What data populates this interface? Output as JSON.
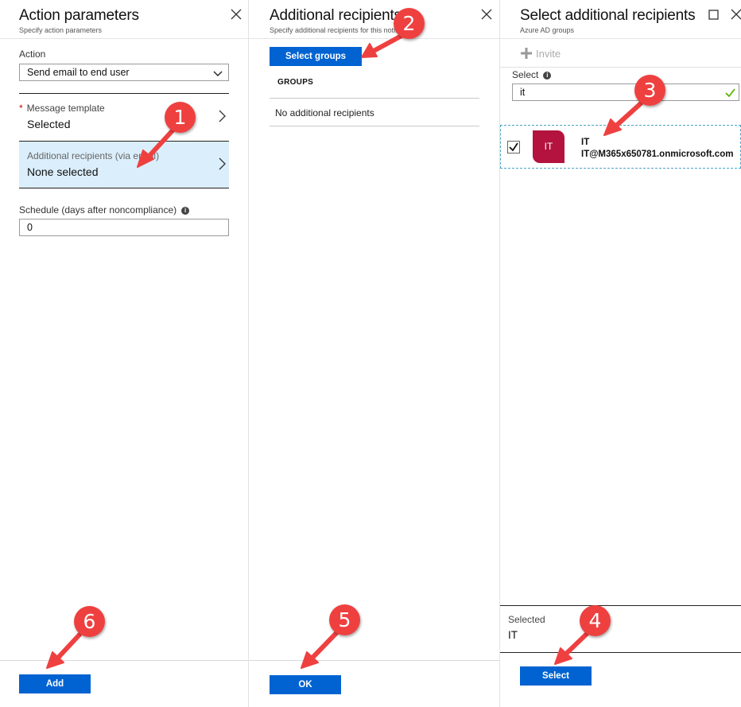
{
  "blade1": {
    "title": "Action parameters",
    "subtitle": "Specify action parameters",
    "action_label": "Action",
    "action_value": "Send email to end user",
    "required_mark": "*",
    "message_template_label": "Message template",
    "message_template_value": "Selected",
    "additional_label": "Additional recipients (via email)",
    "additional_value": "None selected",
    "schedule_label": "Schedule (days after noncompliance)",
    "schedule_value": "0",
    "add_button": "Add"
  },
  "blade2": {
    "title": "Additional recipients",
    "subtitle": "Specify additional recipients for this notification",
    "select_groups_button": "Select groups",
    "groups_header": "GROUPS",
    "empty_text": "No additional recipients",
    "ok_button": "OK"
  },
  "blade3": {
    "title": "Select additional recipients",
    "subtitle": "Azure AD groups",
    "invite_label": "Invite",
    "select_label": "Select",
    "search_value": "it",
    "group": {
      "initials": "IT",
      "name": "IT",
      "email": "IT@M365x650781.onmicrosoft.com",
      "color": "#b3133e"
    },
    "selected_label": "Selected",
    "selected_value": "IT",
    "select_button": "Select"
  },
  "callouts": [
    "1",
    "2",
    "3",
    "4",
    "5",
    "6"
  ],
  "colors": {
    "accent": "#0063d1",
    "callout": "#ef4040",
    "highlight": "#dbeefb",
    "valid": "#5cb500"
  }
}
